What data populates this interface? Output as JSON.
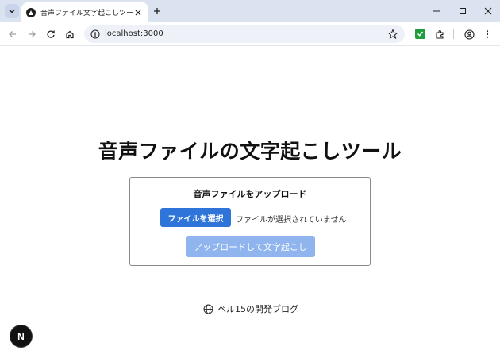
{
  "browser": {
    "tab": {
      "title": "音声ファイル文字起こしツール"
    },
    "address": {
      "url": "localhost:3000"
    }
  },
  "page": {
    "title": "音声ファイルの文字起こしツール",
    "card": {
      "title": "音声ファイルをアップロード",
      "file_button": "ファイルを選択",
      "file_status": "ファイルが選択されていません",
      "upload_button": "アップロードして文字起こし"
    },
    "footer_link": "ペル15の開発ブログ",
    "badge_letter": "N"
  },
  "icons": {
    "tab_search": "chevron-down-icon",
    "favicon": "triangle-logo-icon",
    "tab_close": "close-icon",
    "new_tab": "plus-icon",
    "back": "arrow-left-icon",
    "forward": "arrow-right-icon",
    "reload": "reload-icon",
    "home": "home-icon",
    "site_info": "info-icon",
    "bookmark": "star-icon",
    "extension_check": "check-icon",
    "extensions": "puzzle-icon",
    "profile": "profile-icon",
    "menu": "kebab-icon",
    "globe": "globe-icon"
  },
  "colors": {
    "tabstrip": "#dbe3f1",
    "primary_button": "#2f74d9",
    "disabled_button": "#8fb4ee",
    "extension_green": "#1e9e3a"
  }
}
